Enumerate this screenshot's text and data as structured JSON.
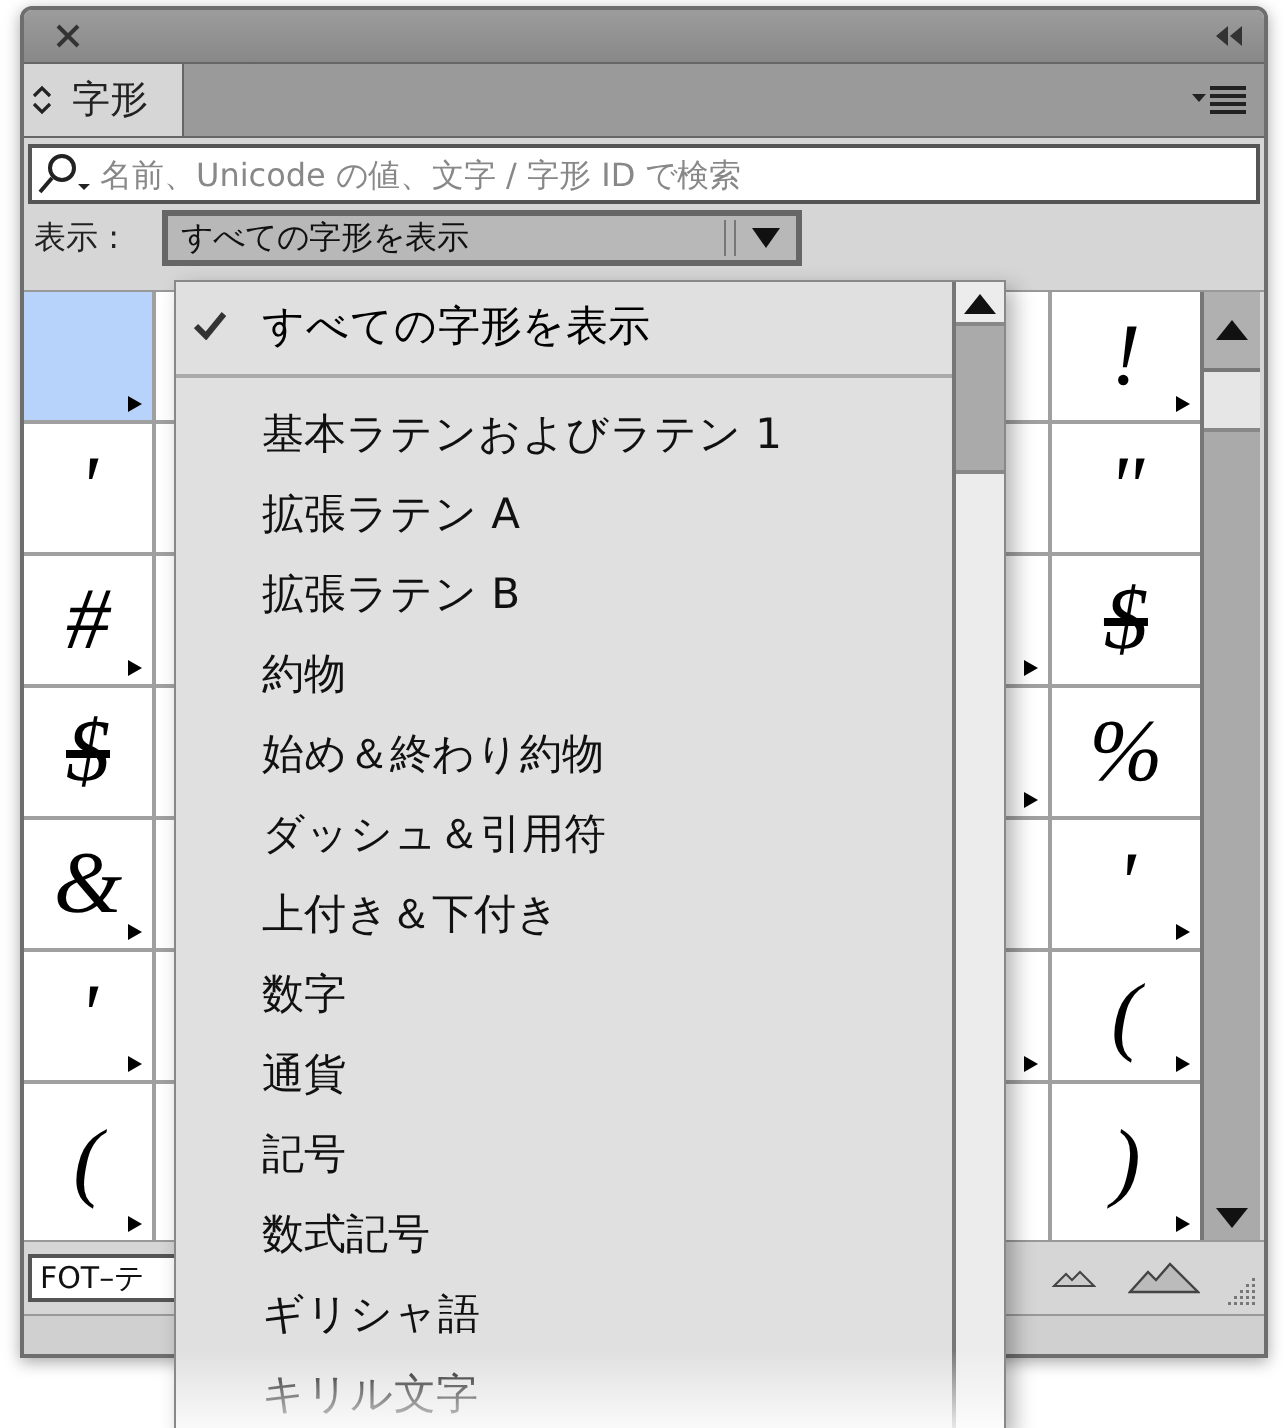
{
  "tab": {
    "label": "字形",
    "selected": true
  },
  "search": {
    "placeholder": "名前、Unicode の値、文字 / 字形 ID で検索"
  },
  "show": {
    "label": "表示 :",
    "value": "すべての字形を表示"
  },
  "grid": {
    "rows": [
      {
        "left": {
          "alt": true,
          "selected": true
        },
        "partial": {
          "alt": false
        },
        "right": {
          "glyph": "!",
          "alt": true,
          "selected": false
        }
      },
      {
        "left": {
          "glyph": "'",
          "alt": false,
          "selected": false
        },
        "partial": {
          "alt": false
        },
        "right": {
          "glyph": "\"",
          "alt": false,
          "selected": false
        }
      },
      {
        "left": {
          "glyph": "#",
          "alt": true,
          "selected": false
        },
        "partial": {
          "alt": true
        },
        "right": {
          "glyph": "$",
          "alt": false,
          "selected": false
        }
      },
      {
        "left": {
          "glyph": "$",
          "alt": false,
          "selected": false
        },
        "partial": {
          "alt": true
        },
        "right": {
          "glyph": "%",
          "alt": false,
          "selected": false
        }
      },
      {
        "left": {
          "glyph": "&",
          "alt": true,
          "selected": false
        },
        "partial": {
          "alt": false
        },
        "right": {
          "glyph": "'",
          "alt": true,
          "selected": false
        }
      },
      {
        "left": {
          "glyph": "'",
          "alt": true,
          "selected": false
        },
        "partial": {
          "alt": true
        },
        "right": {
          "glyph": "(",
          "alt": true,
          "selected": false
        }
      },
      {
        "left": {
          "glyph": "(",
          "alt": true,
          "selected": false
        },
        "partial": {
          "alt": false
        },
        "right": {
          "glyph": ")",
          "alt": true,
          "selected": false
        }
      }
    ]
  },
  "font_field": {
    "value": "FOT–テ"
  },
  "menu": {
    "items": [
      {
        "label": "すべての字形を表示",
        "selected": true,
        "separator_after": true
      },
      {
        "label": "基本ラテンおよびラテン 1",
        "selected": false,
        "separator_after": false
      },
      {
        "label": "拡張ラテン A",
        "selected": false,
        "separator_after": false
      },
      {
        "label": "拡張ラテン B",
        "selected": false,
        "separator_after": false
      },
      {
        "label": "約物",
        "selected": false,
        "separator_after": false
      },
      {
        "label": "始め＆終わり約物",
        "selected": false,
        "separator_after": false
      },
      {
        "label": "ダッシュ＆引用符",
        "selected": false,
        "separator_after": false
      },
      {
        "label": "上付き＆下付き",
        "selected": false,
        "separator_after": false
      },
      {
        "label": "数字",
        "selected": false,
        "separator_after": false
      },
      {
        "label": "通貨",
        "selected": false,
        "separator_after": false
      },
      {
        "label": "記号",
        "selected": false,
        "separator_after": false
      },
      {
        "label": "数式記号",
        "selected": false,
        "separator_after": false
      },
      {
        "label": "ギリシャ語",
        "selected": false,
        "separator_after": false
      },
      {
        "label": "キリル文字",
        "selected": false,
        "separator_after": false
      }
    ]
  }
}
